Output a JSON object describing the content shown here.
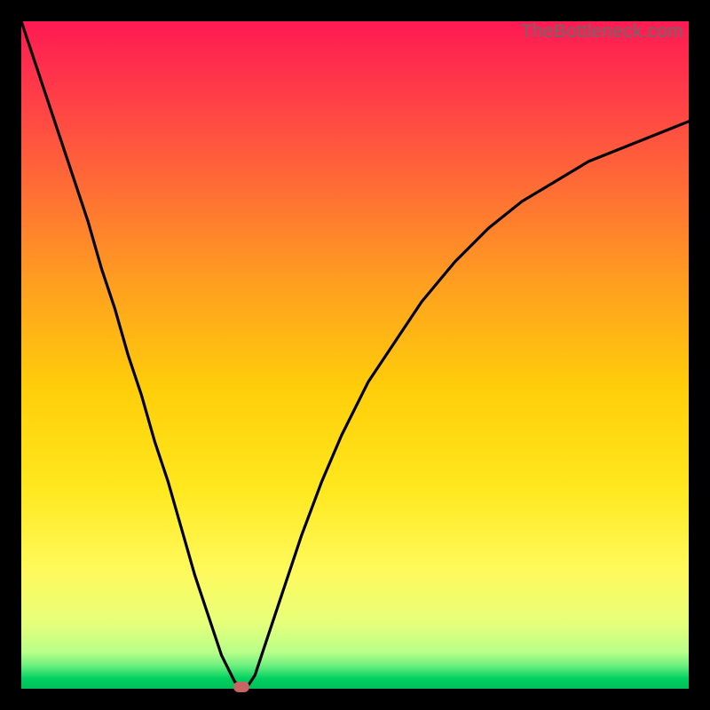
{
  "watermark": "TheBottleneck.com",
  "colors": {
    "background": "#000000",
    "curve": "#000000",
    "marker": "#c96464",
    "gradient_top": "#ff1a53",
    "gradient_upper_mid": "#ff7a2e",
    "gradient_mid": "#ffd200",
    "gradient_lower_mid": "#fff23a",
    "gradient_green": "#00d060"
  },
  "chart_data": {
    "type": "line",
    "title": "",
    "xlabel": "",
    "ylabel": "",
    "xlim": [
      0,
      100
    ],
    "ylim": [
      0,
      100
    ],
    "series": [
      {
        "name": "bottleneck-curve",
        "x": [
          0,
          2,
          4,
          6,
          8,
          10,
          12,
          14,
          16,
          18,
          20,
          22,
          24,
          26,
          28,
          30,
          31,
          32,
          33,
          34,
          35,
          36,
          38,
          40,
          42,
          45,
          48,
          52,
          56,
          60,
          65,
          70,
          75,
          80,
          85,
          90,
          95,
          100
        ],
        "y": [
          100,
          94,
          88,
          82,
          76,
          70,
          63,
          57,
          50,
          44,
          37,
          31,
          24,
          17,
          11,
          5,
          3,
          1,
          0.3,
          0.5,
          2,
          5,
          11,
          17,
          23,
          31,
          38,
          46,
          52,
          58,
          64,
          69,
          73,
          76,
          79,
          81,
          83,
          85
        ]
      }
    ],
    "marker": {
      "x": 33,
      "y": 0.3
    },
    "gradient_stops": [
      {
        "pos": 0.0,
        "color": "#ff1a53"
      },
      {
        "pos": 0.1,
        "color": "#ff3a49"
      },
      {
        "pos": 0.25,
        "color": "#ff6d35"
      },
      {
        "pos": 0.4,
        "color": "#ffa11f"
      },
      {
        "pos": 0.55,
        "color": "#ffce0a"
      },
      {
        "pos": 0.7,
        "color": "#ffe81e"
      },
      {
        "pos": 0.82,
        "color": "#fff95a"
      },
      {
        "pos": 0.9,
        "color": "#e8ff7a"
      },
      {
        "pos": 0.945,
        "color": "#b9ff8a"
      },
      {
        "pos": 0.965,
        "color": "#6ef07f"
      },
      {
        "pos": 0.985,
        "color": "#00d060"
      },
      {
        "pos": 1.0,
        "color": "#00c058"
      }
    ]
  }
}
